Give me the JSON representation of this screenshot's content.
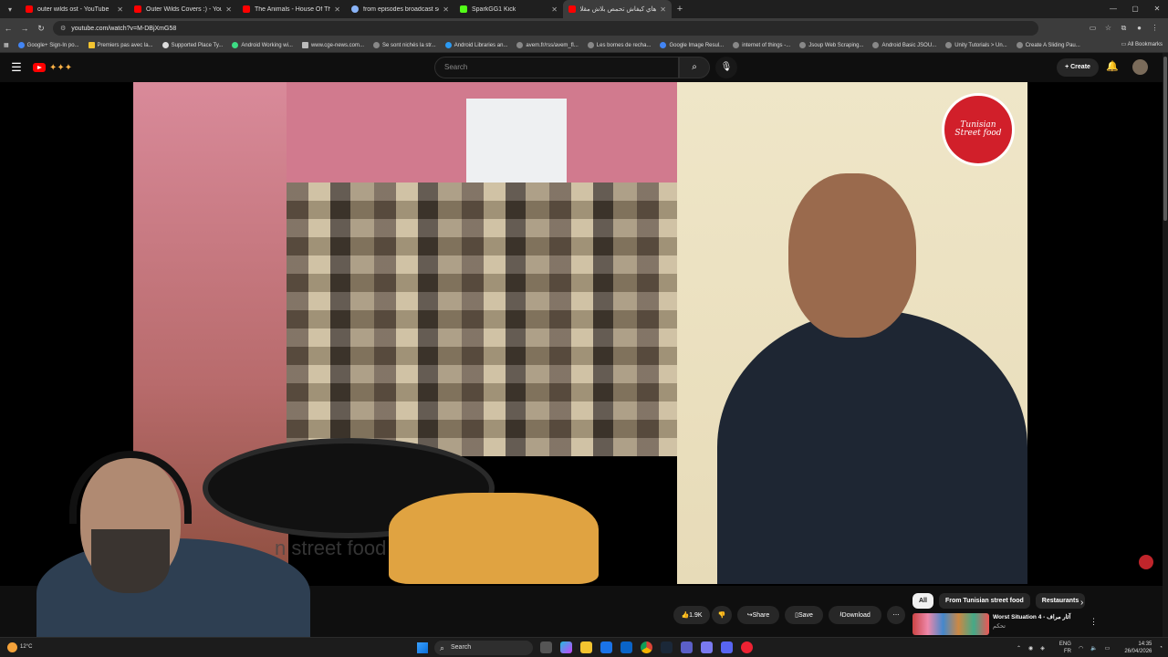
{
  "browser": {
    "tabs": [
      {
        "title": "outer wilds ost - YouTube",
        "favicon_color": "#ff0000"
      },
      {
        "title": "Outer Wilds Covers :) - YouTube",
        "favicon_color": "#ff0000"
      },
      {
        "title": "The Animals - House Of The Ris",
        "favicon_color": "#ff0000"
      },
      {
        "title": "from episodes broadcast sched",
        "favicon_color": "#8ab4f8"
      },
      {
        "title": "SparkGG1 Kick",
        "favicon_color": "#53fc18"
      },
      {
        "title": "هاي كيفاش تحمص بلاش مقلاة",
        "favicon_color": "#ff0000",
        "active": true
      }
    ],
    "url": "youtube.com/watch?v=M-DBjXmG58",
    "bookmarks": [
      "Google+ Sign-In po...",
      "Premiers pas avec la...",
      "Supported Place Ty...",
      "Android Working wi...",
      "www.cge-news.com...",
      "Se sont nichés la str...",
      "Android Libraries an...",
      "avem.fr/rss/avem_fl...",
      "Les bornes de recha...",
      "Google Image Resul...",
      "internet of things -...",
      "Jsoup Web Scraping...",
      "Android Basic JSOU...",
      "Unity Tutorials > Un...",
      "Create A Sliding Pau..."
    ],
    "all_bookmarks_label": "All Bookmarks"
  },
  "youtube": {
    "search_placeholder": "Search",
    "create_label": "Create",
    "video": {
      "channel_logo_text": "Tunisian Street food",
      "watermark_text": "n street food"
    },
    "actions": {
      "like_count": "1.9K",
      "share_label": "Share",
      "save_label": "Save",
      "download_label": "Download"
    },
    "chips": [
      {
        "label": "All",
        "active": true
      },
      {
        "label": "From Tunisian street food",
        "active": false
      },
      {
        "label": "Restaurants",
        "active": false
      }
    ],
    "recommendation": {
      "title": "Worst Situation 4 - آثار مراف",
      "subtitle": "تحكم"
    }
  },
  "taskbar": {
    "weather_temp": "12°C",
    "search_placeholder": "Search",
    "language_top": "ENG",
    "language_bottom": "FR",
    "time": "14:35",
    "date": "26/04/2026"
  },
  "colors": {
    "youtube_red": "#ff0000",
    "background": "#0f0f0f",
    "pill_bg": "#272727"
  }
}
